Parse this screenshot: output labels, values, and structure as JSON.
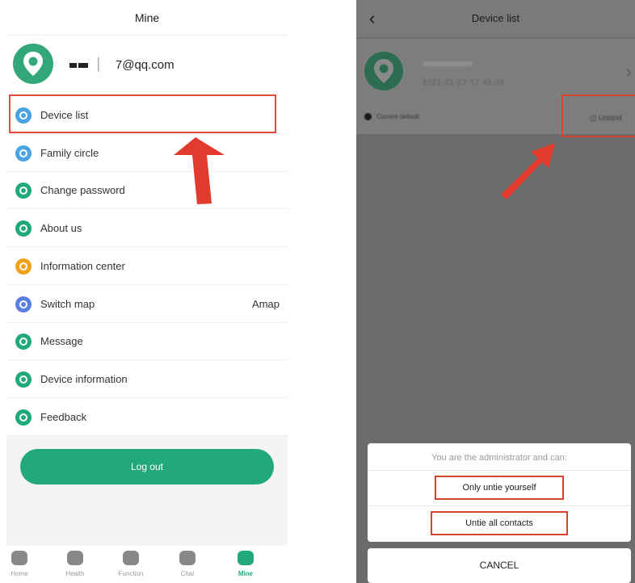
{
  "left": {
    "title": "Mine",
    "account": "7@qq.com",
    "menu": [
      {
        "label": "Device list",
        "value": "",
        "icon": "device-list-icon",
        "color": "#4aa3e2"
      },
      {
        "label": "Family circle",
        "value": "",
        "icon": "family-circle-icon",
        "color": "#4aa3e2"
      },
      {
        "label": "Change password",
        "value": "",
        "icon": "lock-icon",
        "color": "#22a97b"
      },
      {
        "label": "About us",
        "value": "",
        "icon": "info-icon",
        "color": "#22a97b"
      },
      {
        "label": "Information center",
        "value": "",
        "icon": "bell-icon",
        "color": "#f0a21a"
      },
      {
        "label": "Switch map",
        "value": "Amap",
        "icon": "map-icon",
        "color": "#5b7fe0"
      },
      {
        "label": "Message",
        "value": "",
        "icon": "message-icon",
        "color": "#22a97b"
      },
      {
        "label": "Device information",
        "value": "",
        "icon": "device-info-icon",
        "color": "#22a97b"
      },
      {
        "label": "Feedback",
        "value": "",
        "icon": "feedback-icon",
        "color": "#22a97b"
      }
    ],
    "logout_label": "Log out",
    "tabs": [
      {
        "label": "Home",
        "icon": "home-icon",
        "active": false
      },
      {
        "label": "Health",
        "icon": "health-icon",
        "active": false
      },
      {
        "label": "Function",
        "icon": "function-icon",
        "active": false
      },
      {
        "label": "Chat",
        "icon": "chat-icon",
        "active": false
      },
      {
        "label": "Mine",
        "icon": "mine-icon",
        "active": true
      }
    ]
  },
  "right": {
    "title": "Device list",
    "device_date": "2021-11-27 17:41:09",
    "default_label": "Current default",
    "unbind_label": "Unbind",
    "sheet": {
      "title": "You are the administrator and can:",
      "option1": "Only untie yourself",
      "option2": "Untie all contacts",
      "cancel": "CANCEL"
    }
  },
  "colors": {
    "accent": "#22a97b",
    "highlight": "#e44a3e",
    "overlay": "#6c6c6c"
  }
}
